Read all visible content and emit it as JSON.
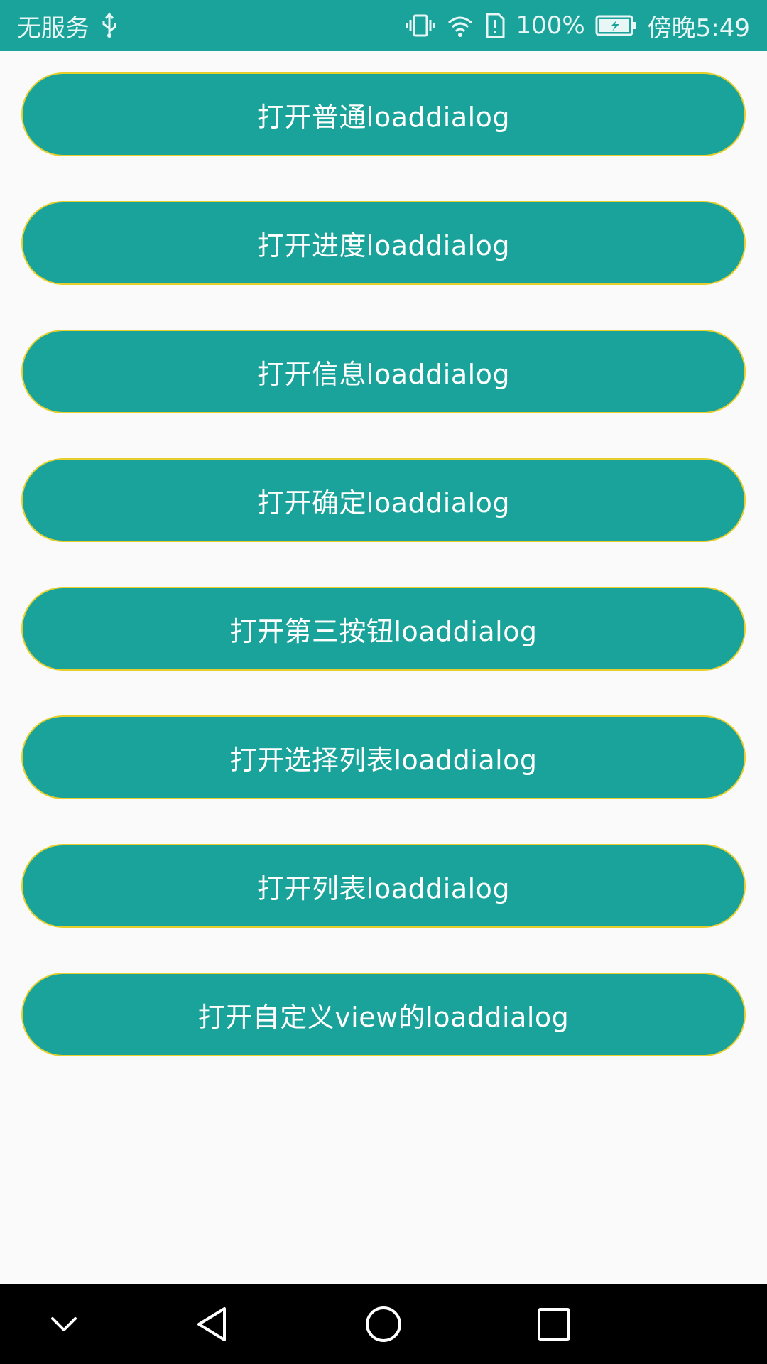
{
  "status_bar": {
    "carrier": "无服务",
    "battery": "100%",
    "time": "傍晚5:49",
    "icons": [
      "usb-icon",
      "vibrate-icon",
      "wifi-icon",
      "sim-alert-icon",
      "battery-icon"
    ]
  },
  "buttons": [
    {
      "label": "打开普通loaddialog"
    },
    {
      "label": "打开进度loaddialog"
    },
    {
      "label": "打开信息loaddialog"
    },
    {
      "label": "打开确定loaddialog"
    },
    {
      "label": "打开第三按钮loaddialog"
    },
    {
      "label": "打开选择列表loaddialog"
    },
    {
      "label": "打开列表loaddialog"
    },
    {
      "label": "打开自定义view的loaddialog"
    }
  ],
  "nav_bar": {
    "items": [
      "collapse-icon",
      "back-icon",
      "home-icon",
      "recents-icon"
    ]
  },
  "colors": {
    "primary": "#1aa39a",
    "button_border": "#e6cf2a",
    "background": "#fafafa",
    "nav_background": "#000000"
  }
}
